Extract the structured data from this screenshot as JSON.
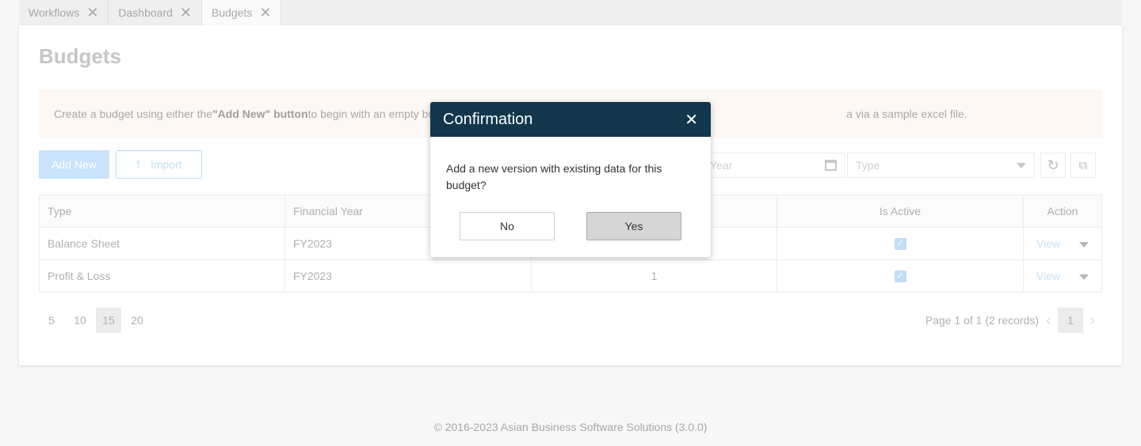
{
  "tabs": [
    {
      "label": "Workflows"
    },
    {
      "label": "Dashboard"
    },
    {
      "label": "Budgets"
    }
  ],
  "page": {
    "title": "Budgets",
    "info_prefix": "Create a budget using either the ",
    "info_bold": "\"Add New\" button",
    "info_mid": " to begin with an empty bu",
    "info_suffix": "a via a sample excel file."
  },
  "toolbar": {
    "add_label": "Add New",
    "import_label": "Import",
    "fy_placeholder": "Year",
    "type_placeholder": "Type"
  },
  "table": {
    "headers": [
      "Type",
      "Financial Year",
      "",
      "Is Active",
      "Action"
    ],
    "rows": [
      {
        "type": "Balance Sheet",
        "fy": "FY2023",
        "version": "",
        "action": "View"
      },
      {
        "type": "Profit & Loss",
        "fy": "FY2023",
        "version": "1",
        "action": "View"
      }
    ]
  },
  "pagination": {
    "sizes": [
      "5",
      "10",
      "15",
      "20"
    ],
    "selected_size": "15",
    "summary": "Page 1 of 1 (2 records)",
    "current": "1"
  },
  "footer": {
    "text": "© 2016-2023 Asian Business Software Solutions (3.0.0)"
  },
  "dialog": {
    "title": "Confirmation",
    "message": "Add a new version with existing data for this budget?",
    "no_label": "No",
    "yes_label": "Yes"
  },
  "colors": {
    "dialog_header": "#12374d",
    "accent_disabled": "#c8e3fb"
  }
}
